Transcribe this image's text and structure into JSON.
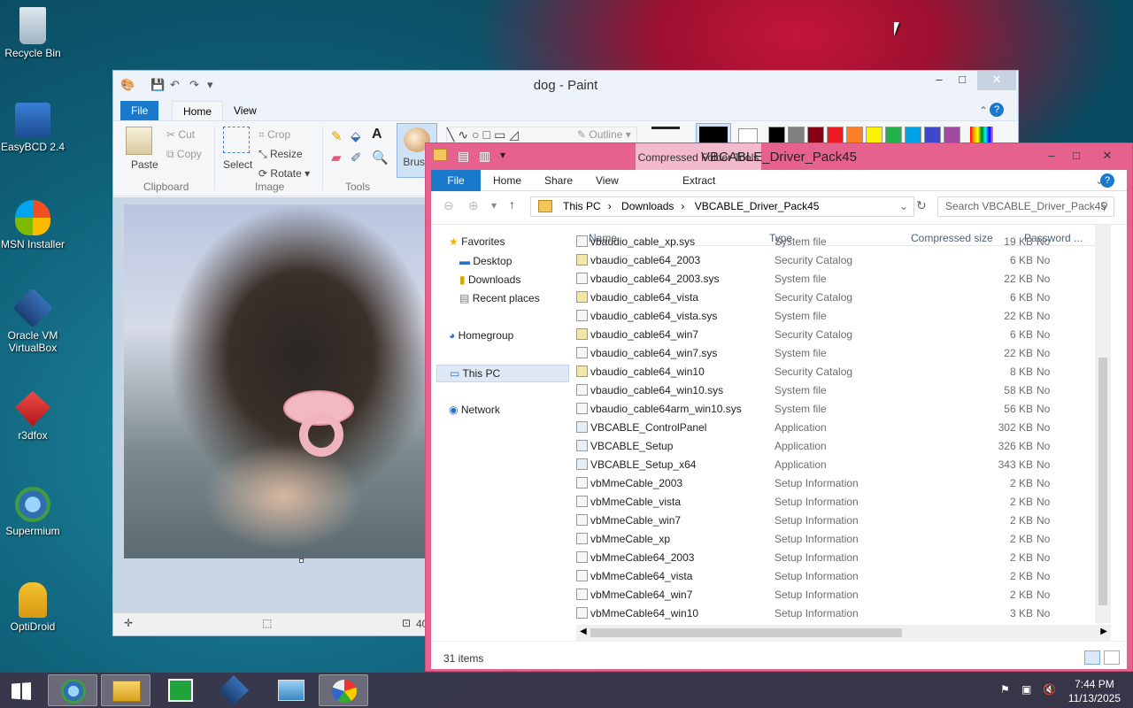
{
  "desktop": {
    "icons": [
      {
        "label": "Recycle Bin",
        "icon": "recycle-bin-icon"
      },
      {
        "label": "EasyBCD 2.4",
        "icon": "easybcd-icon"
      },
      {
        "label": "MSN Installer",
        "icon": "msn-butterfly-icon"
      },
      {
        "label": "Oracle VM VirtualBox",
        "icon": "virtualbox-icon"
      },
      {
        "label": "r3dfox",
        "icon": "r3dfox-icon"
      },
      {
        "label": "Supermium",
        "icon": "supermium-icon"
      },
      {
        "label": "OptiDroid",
        "icon": "android-icon"
      }
    ]
  },
  "paint": {
    "title": "dog - Paint",
    "tabs": {
      "file": "File",
      "home": "Home",
      "view": "View"
    },
    "clipboard": {
      "paste": "Paste",
      "cut": "Cut",
      "copy": "Copy",
      "group": "Clipboard"
    },
    "image": {
      "select": "Select",
      "crop": "Crop",
      "resize": "Resize",
      "rotate": "Rotate",
      "group": "Image"
    },
    "tools": {
      "group": "Tools"
    },
    "brushes": "Brush",
    "outline": "Outline",
    "palette": [
      "#000000",
      "#7f7f7f",
      "#880015",
      "#ed1c24",
      "#ff7f27",
      "#fff200",
      "#22b14c",
      "#00a2e8",
      "#3f48cc",
      "#a349a4"
    ],
    "status_zoom": "40"
  },
  "explorer": {
    "title": "VBCABLE_Driver_Pack45",
    "context_tab": "Compressed Folder Tools",
    "extract": "Extract",
    "tabs": {
      "file": "File",
      "home": "Home",
      "share": "Share",
      "view": "View"
    },
    "breadcrumb": [
      "This PC",
      "Downloads",
      "VBCABLE_Driver_Pack45"
    ],
    "search_placeholder": "Search VBCABLE_Driver_Pack45",
    "nav": {
      "favorites": "Favorites",
      "desktop": "Desktop",
      "downloads": "Downloads",
      "recent": "Recent places",
      "homegroup": "Homegroup",
      "thispc": "This PC",
      "network": "Network"
    },
    "columns": {
      "name": "Name",
      "type": "Type",
      "size": "Compressed size",
      "password": "Password ..."
    },
    "files": [
      {
        "name": "vbaudio_cable_xp.sys",
        "type": "System file",
        "size": "19 KB",
        "password": "No"
      },
      {
        "name": "vbaudio_cable64_2003",
        "type": "Security Catalog",
        "size": "6 KB",
        "password": "No"
      },
      {
        "name": "vbaudio_cable64_2003.sys",
        "type": "System file",
        "size": "22 KB",
        "password": "No"
      },
      {
        "name": "vbaudio_cable64_vista",
        "type": "Security Catalog",
        "size": "6 KB",
        "password": "No"
      },
      {
        "name": "vbaudio_cable64_vista.sys",
        "type": "System file",
        "size": "22 KB",
        "password": "No"
      },
      {
        "name": "vbaudio_cable64_win7",
        "type": "Security Catalog",
        "size": "6 KB",
        "password": "No"
      },
      {
        "name": "vbaudio_cable64_win7.sys",
        "type": "System file",
        "size": "22 KB",
        "password": "No"
      },
      {
        "name": "vbaudio_cable64_win10",
        "type": "Security Catalog",
        "size": "8 KB",
        "password": "No"
      },
      {
        "name": "vbaudio_cable64_win10.sys",
        "type": "System file",
        "size": "58 KB",
        "password": "No"
      },
      {
        "name": "vbaudio_cable64arm_win10.sys",
        "type": "System file",
        "size": "56 KB",
        "password": "No"
      },
      {
        "name": "VBCABLE_ControlPanel",
        "type": "Application",
        "size": "302 KB",
        "password": "No"
      },
      {
        "name": "VBCABLE_Setup",
        "type": "Application",
        "size": "326 KB",
        "password": "No"
      },
      {
        "name": "VBCABLE_Setup_x64",
        "type": "Application",
        "size": "343 KB",
        "password": "No"
      },
      {
        "name": "vbMmeCable_2003",
        "type": "Setup Information",
        "size": "2 KB",
        "password": "No"
      },
      {
        "name": "vbMmeCable_vista",
        "type": "Setup Information",
        "size": "2 KB",
        "password": "No"
      },
      {
        "name": "vbMmeCable_win7",
        "type": "Setup Information",
        "size": "2 KB",
        "password": "No"
      },
      {
        "name": "vbMmeCable_xp",
        "type": "Setup Information",
        "size": "2 KB",
        "password": "No"
      },
      {
        "name": "vbMmeCable64_2003",
        "type": "Setup Information",
        "size": "2 KB",
        "password": "No"
      },
      {
        "name": "vbMmeCable64_vista",
        "type": "Setup Information",
        "size": "2 KB",
        "password": "No"
      },
      {
        "name": "vbMmeCable64_win7",
        "type": "Setup Information",
        "size": "2 KB",
        "password": "No"
      },
      {
        "name": "vbMmeCable64_win10",
        "type": "Setup Information",
        "size": "3 KB",
        "password": "No"
      }
    ],
    "status": "31 items"
  },
  "taskbar": {
    "time": "7:44 PM",
    "date": "11/13/2025",
    "apps": [
      "start-icon",
      "supermium-icon",
      "file-explorer-icon",
      "store-icon",
      "virtualbox-icon",
      "control-panel-icon",
      "paint-icon"
    ]
  }
}
